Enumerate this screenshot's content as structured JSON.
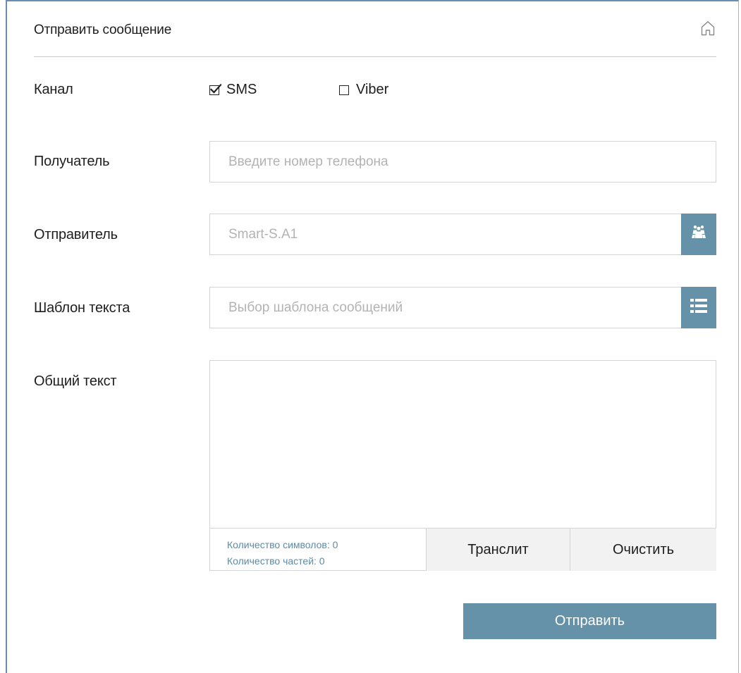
{
  "header": {
    "title": "Отправить сообщение",
    "home_icon": "home-icon"
  },
  "channel": {
    "label": "Канал",
    "options": [
      {
        "label": "SMS",
        "checked": true
      },
      {
        "label": "Viber",
        "checked": false
      }
    ]
  },
  "recipient": {
    "label": "Получатель",
    "value": "",
    "placeholder": "Введите номер телефона"
  },
  "sender": {
    "label": "Отправитель",
    "value": "",
    "placeholder": "Smart-S.A1",
    "button_icon": "group-icon"
  },
  "template": {
    "label": "Шаблон текста",
    "value": "",
    "placeholder": "Выбор шаблона сообщений",
    "button_icon": "list-icon"
  },
  "message": {
    "label": "Общий текст",
    "value": "",
    "char_count_text": "Количество символов: 0",
    "parts_count_text": "Количество частей: 0",
    "translit_label": "Транслит",
    "clear_label": "Очистить"
  },
  "actions": {
    "send_label": "Отправить"
  },
  "colors": {
    "accent": "#6592a8",
    "count_text": "#5b8ba5",
    "panel_border": "#6a8fae"
  }
}
